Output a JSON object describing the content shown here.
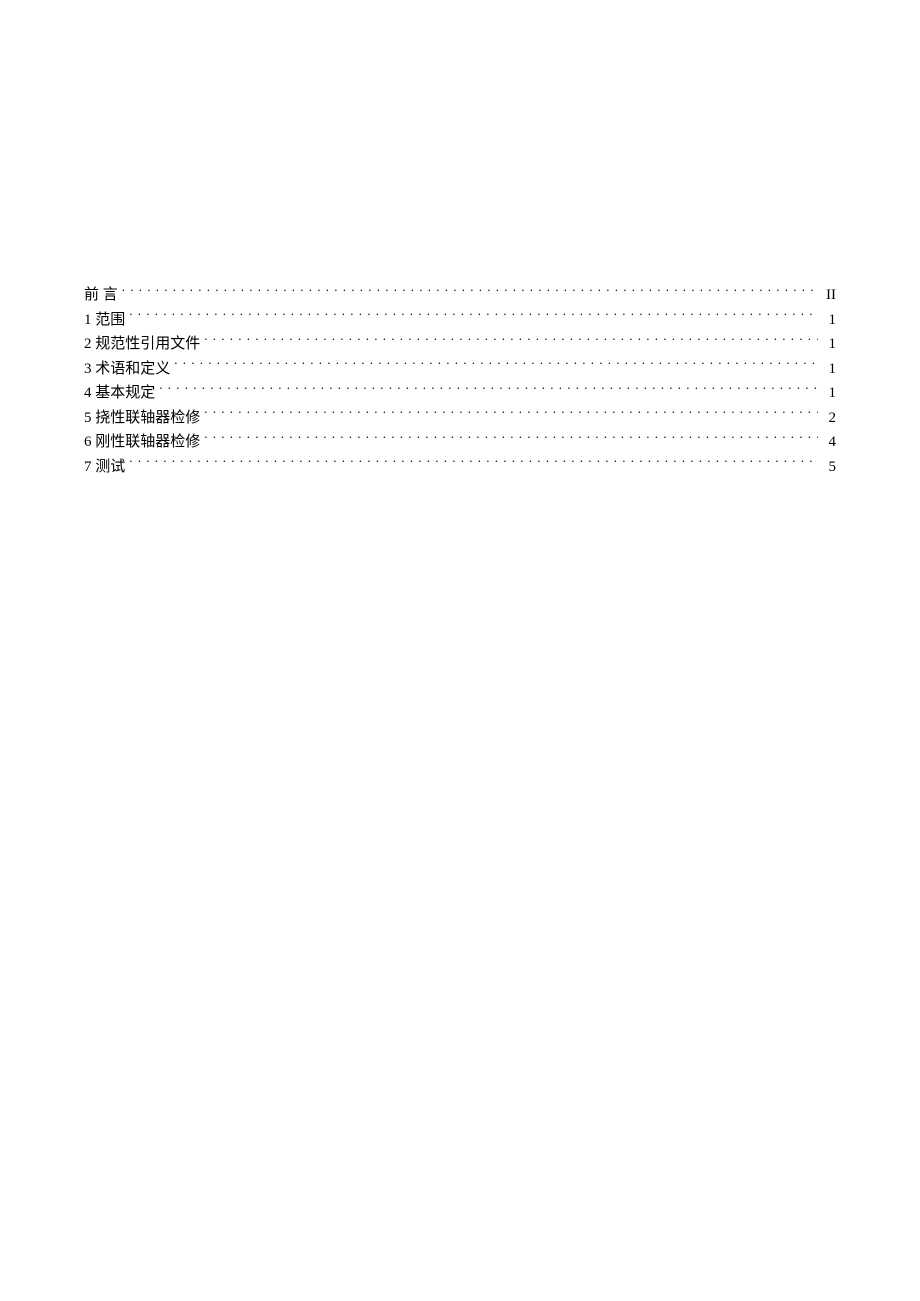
{
  "toc": {
    "entries": [
      {
        "label": "前 言",
        "spaced": true,
        "page": "II"
      },
      {
        "label": "1 范围",
        "spaced": false,
        "page": "1"
      },
      {
        "label": "2 规范性引用文件",
        "spaced": false,
        "page": "1"
      },
      {
        "label": "3 术语和定义",
        "spaced": false,
        "page": "1"
      },
      {
        "label": "4 基本规定",
        "spaced": false,
        "page": "1"
      },
      {
        "label": "5 挠性联轴器检修",
        "spaced": false,
        "page": "2"
      },
      {
        "label": "6 刚性联轴器检修",
        "spaced": false,
        "page": "4"
      },
      {
        "label": "7 测试",
        "spaced": false,
        "page": "5"
      }
    ]
  }
}
